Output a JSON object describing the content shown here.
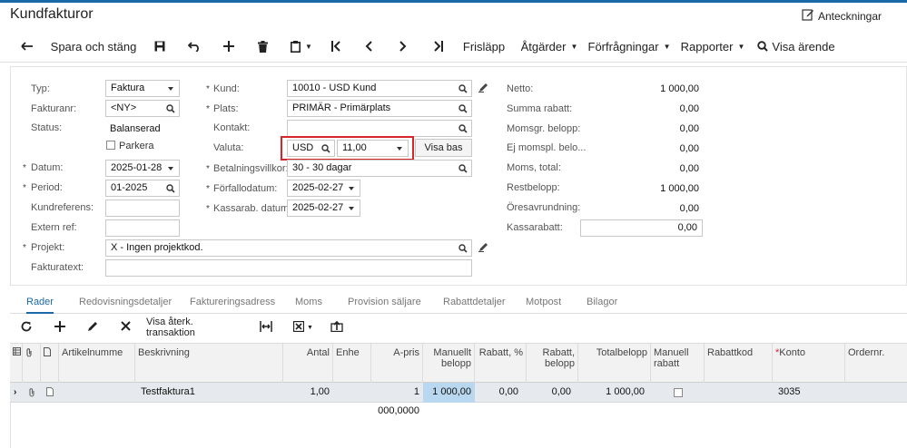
{
  "title": "Kundfakturor",
  "notes_label": "Anteckningar",
  "toolbar": {
    "save_close": "Spara och stäng",
    "frislapp": "Frisläpp",
    "atgarder": "Åtgärder",
    "forfragningar": "Förfrågningar",
    "rapporter": "Rapporter",
    "visa_arende": "Visa ärende"
  },
  "form": {
    "typ_label": "Typ:",
    "typ_value": "Faktura",
    "fakturanr_label": "Fakturanr:",
    "fakturanr_value": "<NY>",
    "status_label": "Status:",
    "status_value": "Balanserad",
    "parkera_label": "Parkera",
    "datum_label": "Datum:",
    "datum_value": "2025-01-28",
    "period_label": "Period:",
    "period_value": "01-2025",
    "kundreferens_label": "Kundreferens:",
    "externref_label": "Extern ref:",
    "projekt_label": "Projekt:",
    "projekt_value": "X - Ingen projektkod.",
    "fakturatext_label": "Fakturatext:",
    "kund_label": "Kund:",
    "kund_value": "10010 - USD Kund",
    "plats_label": "Plats:",
    "plats_value": "PRIMÄR - Primärplats",
    "kontakt_label": "Kontakt:",
    "valuta_label": "Valuta:",
    "valuta_code": "USD",
    "valuta_rate": "11,00",
    "visa_bas": "Visa bas",
    "betvillkor_label": "Betalningsvillkor:",
    "betvillkor_value": "30 - 30 dagar",
    "forfallo_label": "Förfallodatum:",
    "forfallo_value": "2025-02-27",
    "kassarab_label": "Kassarab. datum:",
    "kassarab_value": "2025-02-27"
  },
  "summary": {
    "netto_label": "Netto:",
    "netto": "1 000,00",
    "summarabatt_label": "Summa rabatt:",
    "summarabatt": "0,00",
    "momsgr_label": "Momsgr. belopp:",
    "momsgr": "0,00",
    "ejmoms_label": "Ej momspl. belo...",
    "ejmoms": "0,00",
    "momstotal_label": "Moms, total:",
    "momstotal": "0,00",
    "restbelopp_label": "Restbelopp:",
    "restbelopp": "1 000,00",
    "oresavr_label": "Öresavrundning:",
    "oresavr": "0,00",
    "kassarabatt_label": "Kassarabatt:",
    "kassarabatt": "0,00"
  },
  "tabs": [
    "Rader",
    "Redovisningsdetaljer",
    "Faktureringsadress",
    "Moms",
    "Provision säljare",
    "Rabattdetaljer",
    "Motpost",
    "Bilagor"
  ],
  "grid_toolbar": {
    "visa_aterk": "Visa återk. transaktion"
  },
  "grid_headers": {
    "artikelnummer": "Artikelnumme",
    "beskrivning": "Beskrivning",
    "antal": "Antal",
    "enhet": "Enhe",
    "apris": "A-pris",
    "manuellt_belopp": "Manuellt belopp",
    "rabatt_pct": "Rabatt, %",
    "rabatt_belopp": "Rabatt, belopp",
    "totalbelopp": "Totalbelopp",
    "manuell_rabatt": "Manuell rabatt",
    "rabattkod": "Rabattkod",
    "konto": "Konto",
    "ordernr": "Ordernr."
  },
  "grid_rows": [
    {
      "beskrivning": "Testfaktura1",
      "antal": "1,00",
      "apris": "1 000,0000",
      "manuellt_belopp": "1 000,00",
      "rabatt_pct": "0,00",
      "rabatt_belopp": "0,00",
      "totalbelopp": "1 000,00",
      "konto": "3035"
    }
  ],
  "colors": {
    "accent": "#1b6aa8",
    "highlight": "#d7262a",
    "selected_cell": "#b9d7ef",
    "row_bg": "#e6e9ed"
  }
}
